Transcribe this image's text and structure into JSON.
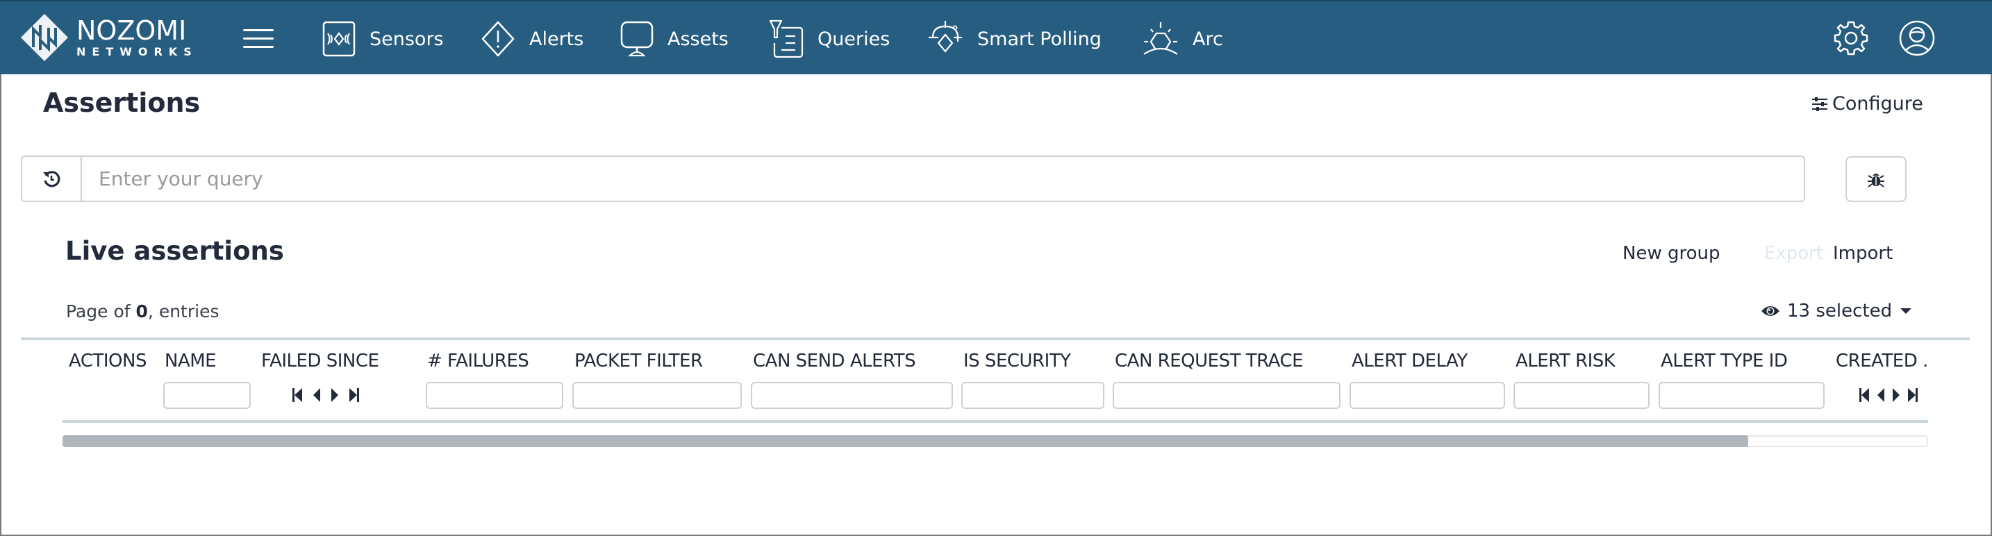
{
  "navbar": {
    "brand_line1": "NOZOMI",
    "brand_line2": "NETWORKS",
    "menu_icon": "hamburger-icon",
    "items": [
      {
        "label": "Sensors",
        "icon": "sensors-icon"
      },
      {
        "label": "Alerts",
        "icon": "alert-diamond-icon"
      },
      {
        "label": "Assets",
        "icon": "monitor-icon"
      },
      {
        "label": "Queries",
        "icon": "funnel-list-icon"
      },
      {
        "label": "Smart Polling",
        "icon": "smart-polling-icon"
      },
      {
        "label": "Arc",
        "icon": "arc-sunrise-icon"
      }
    ],
    "right_icons": [
      "gear-icon",
      "user-circle-icon"
    ],
    "background": "#275d80"
  },
  "page": {
    "title": "Assertions",
    "configure_label": "Configure"
  },
  "query": {
    "history_icon": "history-icon",
    "placeholder": "Enter your query",
    "value": "",
    "debug_icon": "bug-icon"
  },
  "live": {
    "title": "Live assertions",
    "actions": {
      "new_group": "New group",
      "export": "Export",
      "import": "Import"
    },
    "page_info": {
      "prefix": "Page of ",
      "count": "0",
      "suffix": ", entries"
    },
    "columns_selector": {
      "icon": "eye-icon",
      "label": "13 selected"
    }
  },
  "table": {
    "columns": [
      {
        "label": "ACTIONS",
        "filter": "none"
      },
      {
        "label": "NAME",
        "filter": "text",
        "value": ""
      },
      {
        "label": "FAILED SINCE",
        "filter": "pager"
      },
      {
        "label": "# FAILURES",
        "filter": "text",
        "value": ""
      },
      {
        "label": "PACKET FILTER",
        "filter": "text",
        "value": ""
      },
      {
        "label": "CAN SEND ALERTS",
        "filter": "text",
        "value": ""
      },
      {
        "label": "IS SECURITY",
        "filter": "text",
        "value": ""
      },
      {
        "label": "CAN REQUEST TRACE",
        "filter": "text",
        "value": ""
      },
      {
        "label": "ALERT DELAY",
        "filter": "text",
        "value": ""
      },
      {
        "label": "ALERT RISK",
        "filter": "text",
        "value": ""
      },
      {
        "label": "ALERT TYPE ID",
        "filter": "text",
        "value": ""
      },
      {
        "label": "CREATED .",
        "filter": "pager"
      }
    ],
    "rows": [],
    "horizontal_scroll_visible_fraction": 0.905
  }
}
